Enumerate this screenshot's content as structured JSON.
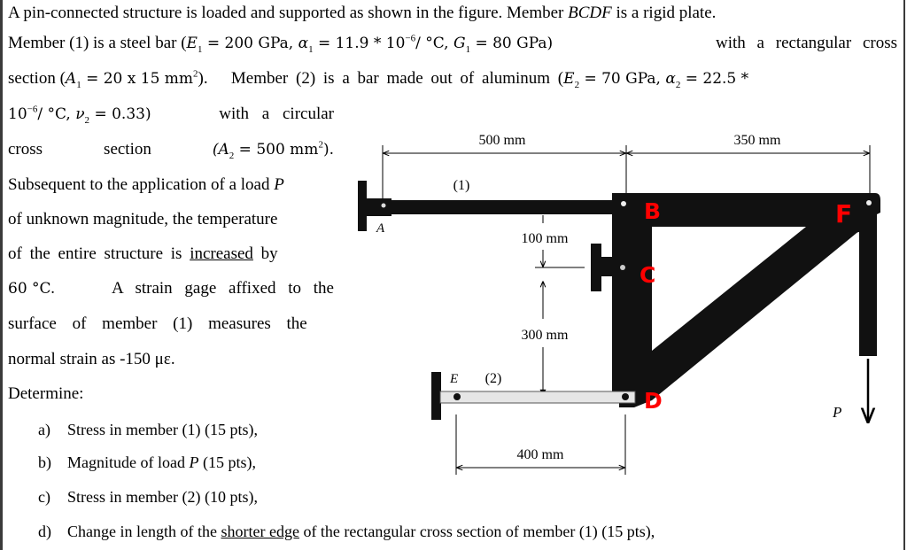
{
  "problem": {
    "line1": {
      "pre": "A pin-connected structure is loaded and supported as shown in the figure. Member ",
      "member_name": "BCDF",
      "post": " is a rigid plate."
    },
    "line2": {
      "pre": "Member (1) is a steel bar (",
      "E1": "E",
      "E1_sub": "1",
      "E1_val": " = 200 GPa, ",
      "a1": "α",
      "a1_sub": "1",
      "a1_val": " = 11.9 * 10",
      "a1_exp": "−6",
      "a1_unit": "/ °C, ",
      "G1": "G",
      "G1_sub": "1",
      "G1_val": " = 80 GPa)",
      "post": "with a rectangular cross"
    },
    "line3": {
      "pre": "section (",
      "A1": "A",
      "A1_sub": "1",
      "A1_val": " = 20 x 15 mm",
      "A1_exp": "2",
      "mid": ").   Member (2) is a bar made out of aluminum (",
      "E2": "E",
      "E2_sub": "2",
      "E2_val": " = 70 GPa, ",
      "a2": "α",
      "a2_sub": "2",
      "a2_val": " = 22.5 *"
    },
    "line4": {
      "pre": "10",
      "exp": "−6",
      "unit": "/ °C, ",
      "v2": "ν",
      "v2_sub": "2",
      "v2_val": " = 0.33)",
      "post": "with a circular"
    },
    "line5": {
      "w1": "cross",
      "w2": "section",
      "A2": "(A",
      "A2_sub": "2",
      "A2_val": " = 500 mm",
      "A2_exp": "2",
      "A2_end": ")."
    },
    "line6": {
      "text": "Subsequent to the application of a load ",
      "P": "P"
    },
    "line7": {
      "text": "of unknown magnitude, the temperature"
    },
    "line8": {
      "pre": "of the entire structure is ",
      "underlined": "increased",
      "post": " by"
    },
    "line9": {
      "temp": "60 °C.",
      "post": "A strain gage affixed to the"
    },
    "line10": {
      "text": "surface of member (1) measures the"
    },
    "line11": {
      "text": "normal strain as -150 με."
    },
    "determine": "Determine:",
    "items": [
      {
        "label": "a)",
        "text": "Stress in member (1) (15 pts),"
      },
      {
        "label": "b)",
        "pre": "Magnitude of load ",
        "P": "P",
        "post": " (15 pts),"
      },
      {
        "label": "c)",
        "text": "Stress in member (2) (10 pts),"
      },
      {
        "label": "d)",
        "pre": "Change in length of the ",
        "underlined": "shorter edge",
        "post": " of the rectangular cross section of member (1) (15 pts),"
      }
    ]
  },
  "figure": {
    "dims": {
      "ab": "500 mm",
      "bf": "350 mm",
      "bc": "100 mm",
      "cd": "300 mm",
      "ed": "400 mm"
    },
    "labels": {
      "member1": "(1)",
      "member2": "(2)",
      "A": "A",
      "E": "E",
      "P": "P",
      "B": "B",
      "C": "C",
      "D": "D",
      "F": "F"
    },
    "colors": {
      "plate": "#111111",
      "annotation_red": "#ff0000",
      "member2_fill": "#e6e6e6"
    }
  }
}
